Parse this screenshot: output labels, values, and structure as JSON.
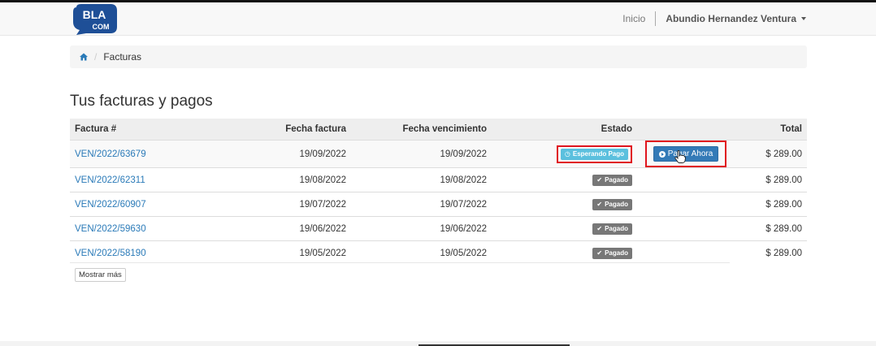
{
  "brand": {
    "logo_text_top": "BLA",
    "logo_text_bottom": "COM"
  },
  "nav": {
    "home_link": "Inicio",
    "user_name": "Abundio Hernandez Ventura"
  },
  "breadcrumb": {
    "icon": "home-icon",
    "current": "Facturas"
  },
  "page": {
    "title": "Tus facturas y pagos"
  },
  "table": {
    "headers": [
      "Factura #",
      "Fecha factura",
      "Fecha vencimiento",
      "Estado",
      "",
      "Total"
    ],
    "rows": [
      {
        "invoice": "VEN/2022/63679",
        "date": "19/09/2022",
        "due": "19/09/2022",
        "status": "Esperando Pago",
        "action": "Pagar Ahora",
        "total": "$ 289.00"
      },
      {
        "invoice": "VEN/2022/62311",
        "date": "19/08/2022",
        "due": "19/08/2022",
        "status": "Pagado",
        "action": "",
        "total": "$ 289.00"
      },
      {
        "invoice": "VEN/2022/60907",
        "date": "19/07/2022",
        "due": "19/07/2022",
        "status": "Pagado",
        "action": "",
        "total": "$ 289.00"
      },
      {
        "invoice": "VEN/2022/59630",
        "date": "19/06/2022",
        "due": "19/06/2022",
        "status": "Pagado",
        "action": "",
        "total": "$ 289.00"
      },
      {
        "invoice": "VEN/2022/58190",
        "date": "19/05/2022",
        "due": "19/05/2022",
        "status": "Pagado",
        "action": "",
        "total": "$ 289.00"
      }
    ]
  },
  "more_button": "Mostrar más",
  "colors": {
    "link": "#2a7ab8",
    "badge_waiting": "#5bc0de",
    "badge_paid": "#777777",
    "pay_button": "#337ab7",
    "highlight": "#e0141e"
  }
}
